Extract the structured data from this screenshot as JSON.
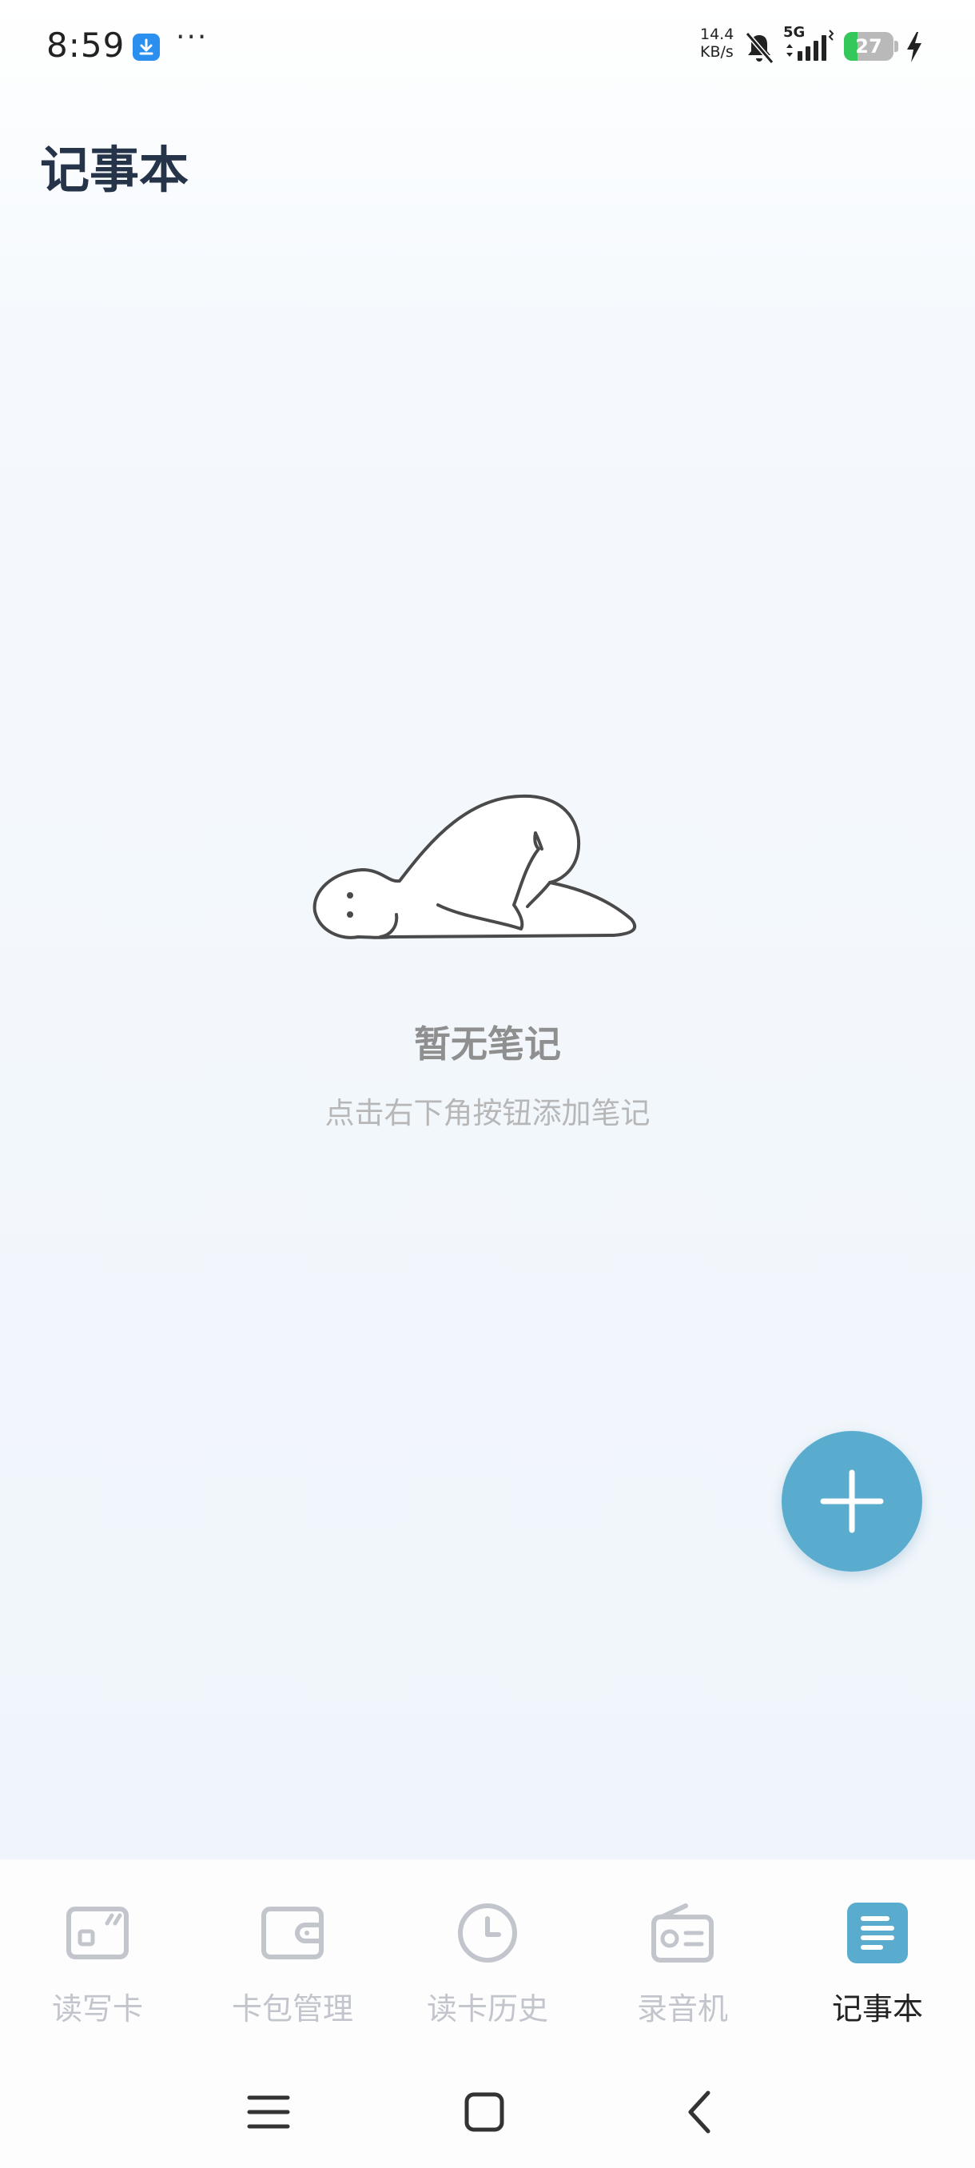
{
  "status_bar": {
    "time": "8:59",
    "more": "···",
    "speed_value": "14.4",
    "speed_unit": "KB/s",
    "network": "5G",
    "battery_level": "27",
    "battery_fraction": 0.27,
    "icons": [
      "download-icon",
      "mute-icon",
      "signal-icon",
      "battery-icon",
      "charging-icon"
    ]
  },
  "header": {
    "title": "记事本"
  },
  "empty_state": {
    "title": "暂无笔记",
    "hint": "点击右下角按钮添加笔记",
    "illustration": "kneeling-figure-illustration"
  },
  "fab": {
    "icon": "plus-icon",
    "color": "#5aacce"
  },
  "bottom_nav": {
    "active_color": "#5aacce",
    "inactive_color": "#c2c5cc",
    "items": [
      {
        "label": "读写卡",
        "icon": "card-read-write-icon",
        "active": false
      },
      {
        "label": "卡包管理",
        "icon": "wallet-icon",
        "active": false
      },
      {
        "label": "读卡历史",
        "icon": "clock-icon",
        "active": false
      },
      {
        "label": "录音机",
        "icon": "radio-icon",
        "active": false
      },
      {
        "label": "记事本",
        "icon": "notepad-icon",
        "active": true
      }
    ]
  },
  "system_nav": {
    "icons": [
      "menu-icon",
      "home-icon",
      "back-icon"
    ]
  }
}
